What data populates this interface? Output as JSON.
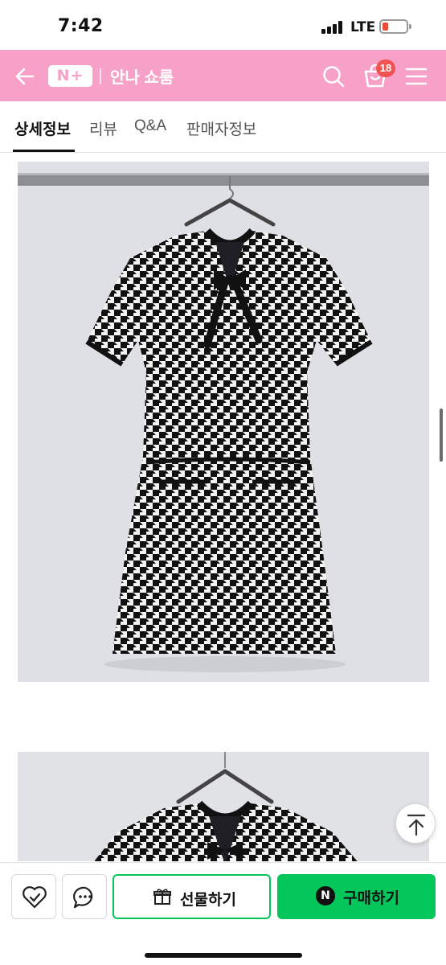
{
  "status_bar": {
    "time": "7:42",
    "network": "LTE",
    "battery_percent": 15
  },
  "header": {
    "logo_text": "N+",
    "store_name": "안나 쇼룸",
    "cart_count": "18",
    "brand_color": "#f7a1c9"
  },
  "tabs": [
    {
      "label": "상세정보",
      "active": true
    },
    {
      "label": "리뷰",
      "active": false
    },
    {
      "label": "Q&A",
      "active": false
    },
    {
      "label": "판매자정보",
      "active": false
    }
  ],
  "content": {
    "images": [
      {
        "subject": "black-and-white houndstooth tweed short-sleeve mini dress with black bow, on hanger"
      },
      {
        "subject": "same dress, second photo (partially visible)"
      }
    ]
  },
  "bottom_bar": {
    "gift_label": "선물하기",
    "buy_label": "구매하기",
    "buy_badge": "N",
    "accent_color": "#03c75a"
  },
  "icons": [
    "back-arrow-icon",
    "search-icon",
    "cart-icon",
    "menu-icon",
    "wishlist-heart-icon",
    "chat-icon",
    "gift-icon",
    "scroll-top-icon"
  ]
}
